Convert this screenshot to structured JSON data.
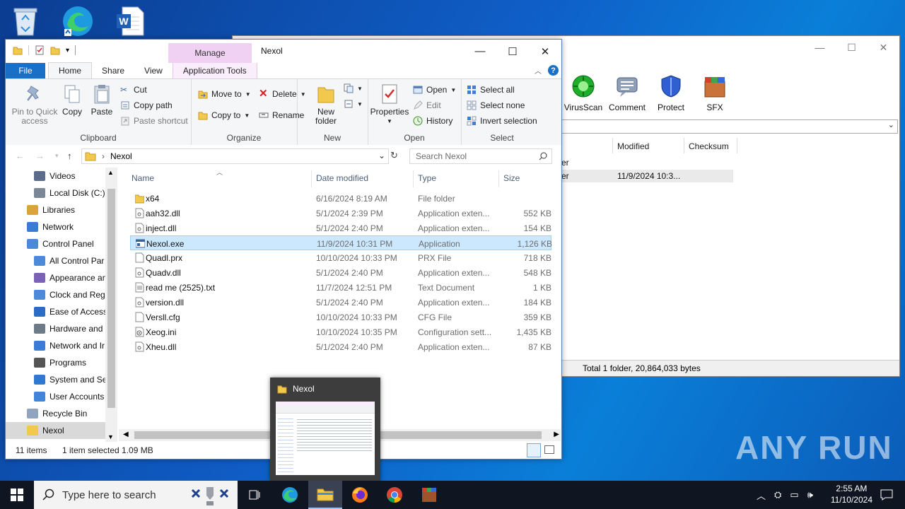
{
  "desktop": {
    "icons": [
      "recycle-bin-icon",
      "edge-icon",
      "word-document-icon"
    ]
  },
  "winrar": {
    "toolbar": [
      {
        "label": "VirusScan",
        "icon": "virusscan-icon",
        "color": "#1fae2b"
      },
      {
        "label": "Comment",
        "icon": "comment-icon",
        "color": "#6b7e99"
      },
      {
        "label": "Protect",
        "icon": "protect-icon",
        "color": "#2f5fd0"
      },
      {
        "label": "SFX",
        "icon": "sfx-icon",
        "color": "#d93d2b"
      }
    ],
    "columns": [
      "Modified",
      "Checksum"
    ],
    "rows": [
      {
        "name_fragment": "er",
        "modified": ""
      },
      {
        "name_fragment": "er",
        "modified": "11/9/2024 10:3..."
      }
    ],
    "status": "Total 1 folder, 20,864,033 bytes"
  },
  "explorer": {
    "title": "Nexol",
    "manage_tab": "Manage",
    "tabs": {
      "file": "File",
      "home": "Home",
      "share": "Share",
      "view": "View",
      "app_tools": "Application Tools"
    },
    "ribbon": {
      "clipboard": {
        "pin": "Pin to Quick access",
        "copy": "Copy",
        "paste": "Paste",
        "cut": "Cut",
        "copy_path": "Copy path",
        "paste_shortcut": "Paste shortcut",
        "label": "Clipboard"
      },
      "organize": {
        "move_to": "Move to",
        "delete": "Delete",
        "copy_to": "Copy to",
        "rename": "Rename",
        "label": "Organize"
      },
      "new": {
        "new_folder": "New folder",
        "label": "New"
      },
      "open": {
        "properties": "Properties",
        "open": "Open",
        "edit": "Edit",
        "history": "History",
        "label": "Open"
      },
      "select": {
        "select_all": "Select all",
        "select_none": "Select none",
        "invert": "Invert selection",
        "label": "Select"
      }
    },
    "address": "Nexol",
    "search_placeholder": "Search Nexol",
    "nav": [
      {
        "label": "Videos",
        "icon": "videos-icon"
      },
      {
        "label": "Local Disk (C:)",
        "icon": "drive-icon"
      },
      {
        "label": "Libraries",
        "icon": "libraries-icon"
      },
      {
        "label": "Network",
        "icon": "network-icon"
      },
      {
        "label": "Control Panel",
        "icon": "control-panel-icon"
      },
      {
        "label": "All Control Par",
        "icon": "control-panel-icon"
      },
      {
        "label": "Appearance an",
        "icon": "appearance-icon"
      },
      {
        "label": "Clock and Regi",
        "icon": "clock-icon"
      },
      {
        "label": "Ease of Access",
        "icon": "ease-of-access-icon"
      },
      {
        "label": "Hardware and",
        "icon": "hardware-icon"
      },
      {
        "label": "Network and Ir",
        "icon": "network-internet-icon"
      },
      {
        "label": "Programs",
        "icon": "programs-icon"
      },
      {
        "label": "System and Se",
        "icon": "system-security-icon"
      },
      {
        "label": "User Accounts",
        "icon": "user-accounts-icon"
      },
      {
        "label": "Recycle Bin",
        "icon": "recycle-bin-icon"
      },
      {
        "label": "Nexol",
        "icon": "folder-icon"
      }
    ],
    "columns": {
      "name": "Name",
      "date": "Date modified",
      "type": "Type",
      "size": "Size"
    },
    "files": [
      {
        "name": "x64",
        "date": "6/16/2024 8:19 AM",
        "type": "File folder",
        "size": "",
        "icon": "folder-icon"
      },
      {
        "name": "aah32.dll",
        "date": "5/1/2024 2:39 PM",
        "type": "Application exten...",
        "size": "552 KB",
        "icon": "dll-icon"
      },
      {
        "name": "inject.dll",
        "date": "5/1/2024 2:40 PM",
        "type": "Application exten...",
        "size": "154 KB",
        "icon": "dll-icon"
      },
      {
        "name": "Nexol.exe",
        "date": "11/9/2024 10:31 PM",
        "type": "Application",
        "size": "1,126 KB",
        "icon": "exe-icon"
      },
      {
        "name": "Quadl.prx",
        "date": "10/10/2024 10:33 PM",
        "type": "PRX File",
        "size": "718 KB",
        "icon": "file-icon"
      },
      {
        "name": "Quadv.dll",
        "date": "5/1/2024 2:40 PM",
        "type": "Application exten...",
        "size": "548 KB",
        "icon": "dll-icon"
      },
      {
        "name": "read me (2525).txt",
        "date": "11/7/2024 12:51 PM",
        "type": "Text Document",
        "size": "1 KB",
        "icon": "text-file-icon"
      },
      {
        "name": "version.dll",
        "date": "5/1/2024 2:40 PM",
        "type": "Application exten...",
        "size": "184 KB",
        "icon": "dll-icon"
      },
      {
        "name": "Versll.cfg",
        "date": "10/10/2024 10:33 PM",
        "type": "CFG File",
        "size": "359 KB",
        "icon": "file-icon"
      },
      {
        "name": "Xeog.ini",
        "date": "10/10/2024 10:35 PM",
        "type": "Configuration sett...",
        "size": "1,435 KB",
        "icon": "ini-icon"
      },
      {
        "name": "Xheu.dll",
        "date": "5/1/2024 2:40 PM",
        "type": "Application exten...",
        "size": "87 KB",
        "icon": "dll-icon"
      }
    ],
    "status": {
      "count": "11 items",
      "selected": "1 item selected  1.09 MB"
    }
  },
  "thumbnail": {
    "title": "Nexol"
  },
  "watermark": "ANY RUN",
  "taskbar": {
    "search_placeholder": "Type here to search",
    "time": "2:55 AM",
    "date": "11/10/2024"
  },
  "colors": {
    "accent": "#1a6fc9",
    "selection": "#cce8ff",
    "manage": "#f0d0f3"
  }
}
